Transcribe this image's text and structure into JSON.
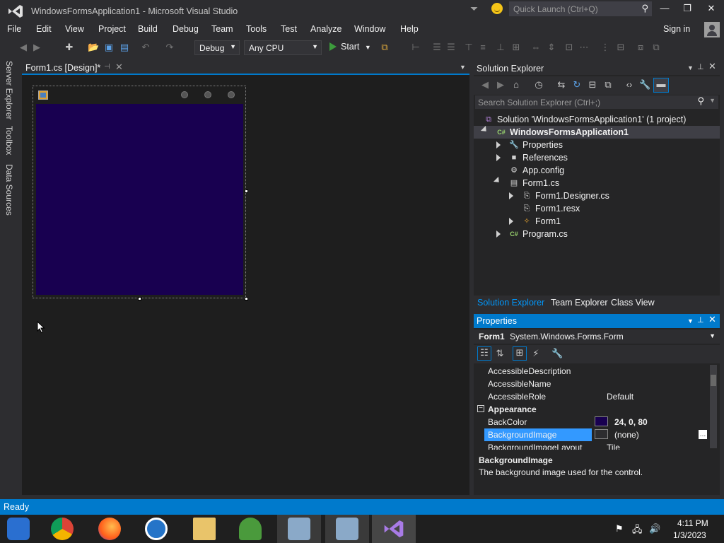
{
  "app": {
    "title": "WindowsFormsApplication1 - Microsoft Visual Studio",
    "quick_launch_placeholder": "Quick Launch (Ctrl+Q)",
    "sign_in": "Sign in"
  },
  "menu": [
    "File",
    "Edit",
    "View",
    "Project",
    "Build",
    "Debug",
    "Team",
    "Tools",
    "Test",
    "Analyze",
    "Window",
    "Help"
  ],
  "toolbar": {
    "config": "Debug",
    "platform": "Any CPU",
    "start": "Start"
  },
  "left_tabs": [
    "Server Explorer",
    "Toolbox",
    "Data Sources"
  ],
  "document_tab": {
    "label": "Form1.cs [Design]*"
  },
  "form_designer": {
    "backcolor": "#180050"
  },
  "solution_explorer": {
    "title": "Solution Explorer",
    "search_placeholder": "Search Solution Explorer (Ctrl+;)",
    "tree": [
      {
        "label": "Solution 'WindowsFormsApplication1' (1 project)",
        "icon": "solution-icon"
      },
      {
        "label": "WindowsFormsApplication1",
        "icon": "csharp-project-icon",
        "bold": true
      },
      {
        "label": "Properties",
        "icon": "wrench-icon"
      },
      {
        "label": "References",
        "icon": "references-icon"
      },
      {
        "label": "App.config",
        "icon": "config-icon"
      },
      {
        "label": "Form1.cs",
        "icon": "form-icon"
      },
      {
        "label": "Form1.Designer.cs",
        "icon": "cs-file-icon"
      },
      {
        "label": "Form1.resx",
        "icon": "resx-icon"
      },
      {
        "label": "Form1",
        "icon": "class-icon"
      },
      {
        "label": "Program.cs",
        "icon": "cs-file-icon"
      }
    ],
    "tabs": [
      "Solution Explorer",
      "Team Explorer",
      "Class View"
    ]
  },
  "properties": {
    "title": "Properties",
    "object_name": "Form1",
    "object_type": "System.Windows.Forms.Form",
    "rows": [
      {
        "name": "AccessibleDescription",
        "value": ""
      },
      {
        "name": "AccessibleName",
        "value": ""
      },
      {
        "name": "AccessibleRole",
        "value": "Default"
      },
      {
        "name": "BackColor",
        "value": "24, 0, 80"
      },
      {
        "name": "BackgroundImage",
        "value": "(none)"
      },
      {
        "name": "BackgroundImageLayout",
        "value": "Tile"
      }
    ],
    "category": "Appearance",
    "desc_title": "BackgroundImage",
    "desc_text": "The background image used for the control."
  },
  "status": {
    "text": "Ready"
  },
  "taskbar": {
    "time": "4:11 PM",
    "date": "1/3/2023"
  },
  "colors": {
    "accent": "#007acc",
    "form_back": "#180050",
    "selection": "#3399ff"
  }
}
